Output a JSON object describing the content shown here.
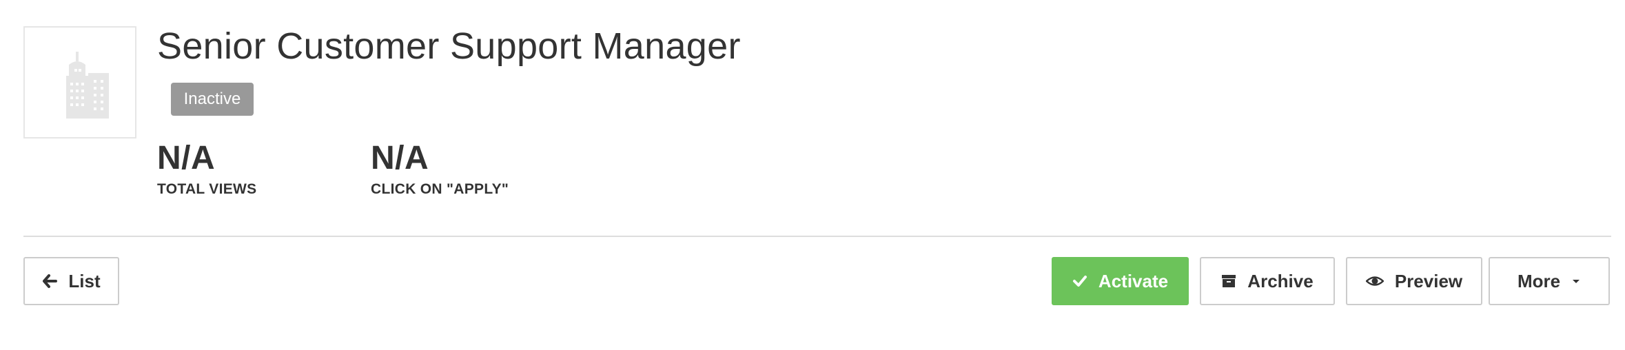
{
  "job": {
    "title": "Senior Customer Support Manager",
    "status": "Inactive",
    "logo_icon": "building-icon"
  },
  "stats": [
    {
      "value": "N/A",
      "label": "TOTAL VIEWS"
    },
    {
      "value": "N/A",
      "label": "CLICK ON \"APPLY\""
    }
  ],
  "toolbar": {
    "list_label": "List",
    "list_icon": "arrow-left-icon",
    "activate_label": "Activate",
    "activate_icon": "check-icon",
    "archive_label": "Archive",
    "archive_icon": "archive-box-icon",
    "preview_label": "Preview",
    "preview_icon": "eye-icon",
    "more_label": "More",
    "more_icon": "caret-down-icon"
  },
  "colors": {
    "activate": "#6cc35a",
    "badge": "#999999",
    "text": "#333333",
    "border": "#cccccc"
  }
}
